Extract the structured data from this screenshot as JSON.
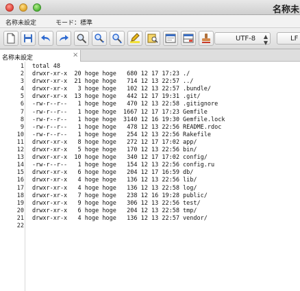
{
  "window": {
    "title": "名称未"
  },
  "menubar": {
    "file_label": "名称未設定",
    "mode_label": "モード：標準"
  },
  "toolbar": {
    "buttons": [
      {
        "icon": "new-document-icon"
      },
      {
        "icon": "save-icon"
      },
      {
        "icon": "undo-icon"
      },
      {
        "icon": "redo-icon"
      },
      {
        "icon": "search-icon"
      },
      {
        "icon": "find-next-icon"
      },
      {
        "icon": "find-previous-icon"
      },
      {
        "icon": "highlight-icon"
      },
      {
        "icon": "grep-icon"
      },
      {
        "icon": "window-icon"
      },
      {
        "icon": "split-window-icon"
      },
      {
        "icon": "stamp-icon"
      }
    ],
    "encoding": "UTF-8",
    "line_ending": "LF"
  },
  "tab": {
    "label": "名称未設定",
    "close": "×"
  },
  "line_numbers": [
    "1",
    "2",
    "3",
    "4",
    "5",
    "6",
    "7",
    "8",
    "9",
    "10",
    "11",
    "12",
    "13",
    "14",
    "15",
    "16",
    "17",
    "18",
    "19",
    "20",
    "21",
    "22"
  ],
  "lines": [
    "total 48",
    "drwxr-xr-x  20 hoge hoge   680 12 17 17:23 ./",
    "drwxr-xr-x  21 hoge hoge   714 12 13 22:57 ../",
    "drwxr-xr-x   3 hoge hoge   102 12 13 22:57 .bundle/",
    "drwxr-xr-x  13 hoge hoge   442 12 17 19:31 .git/",
    "-rw-r--r--   1 hoge hoge   470 12 13 22:58 .gitignore",
    "-rw-r--r--   1 hoge hoge  1667 12 17 17:23 Gemfile",
    "-rw-r--r--   1 hoge hoge  3140 12 16 19:30 Gemfile.lock",
    "-rw-r--r--   1 hoge hoge   478 12 13 22:56 README.rdoc",
    "-rw-r--r--   1 hoge hoge   254 12 13 22:56 Rakefile",
    "drwxr-xr-x   8 hoge hoge   272 12 17 17:02 app/",
    "drwxr-xr-x   5 hoge hoge   170 12 13 22:56 bin/",
    "drwxr-xr-x  10 hoge hoge   340 12 17 17:02 config/",
    "-rw-r--r--   1 hoge hoge   154 12 13 22:56 config.ru",
    "drwxr-xr-x   6 hoge hoge   204 12 17 16:59 db/",
    "drwxr-xr-x   4 hoge hoge   136 12 13 22:56 lib/",
    "drwxr-xr-x   4 hoge hoge   136 12 13 22:58 log/",
    "drwxr-xr-x   7 hoge hoge   238 12 16 19:28 public/",
    "drwxr-xr-x   9 hoge hoge   306 12 13 22:56 test/",
    "drwxr-xr-x   6 hoge hoge   204 12 13 22:58 tmp/",
    "drwxr-xr-x   4 hoge hoge   136 12 13 22:57 vendor/",
    ""
  ]
}
